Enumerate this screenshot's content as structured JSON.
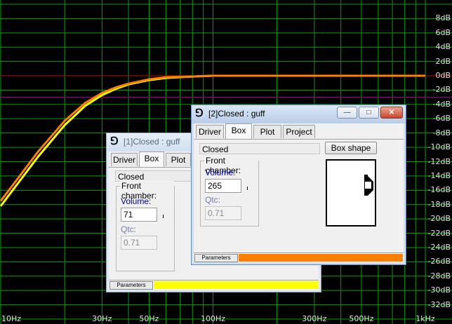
{
  "chart_data": {
    "type": "line",
    "title": "",
    "xlabel": "",
    "ylabel": "",
    "x_scale": "log",
    "xlim": [
      10,
      1000
    ],
    "ylim": [
      -34,
      10
    ],
    "x_ticks": [
      {
        "value": 10,
        "label": "10Hz"
      },
      {
        "value": 30,
        "label": "30Hz"
      },
      {
        "value": 50,
        "label": "50Hz"
      },
      {
        "value": 100,
        "label": "100Hz"
      },
      {
        "value": 300,
        "label": "300Hz"
      },
      {
        "value": 500,
        "label": "500Hz"
      },
      {
        "value": 1000,
        "label": "1kHz"
      }
    ],
    "y_ticks": [
      {
        "value": 8,
        "label": "8dB"
      },
      {
        "value": 6,
        "label": "6dB"
      },
      {
        "value": 4,
        "label": "4dB"
      },
      {
        "value": 2,
        "label": "2dB"
      },
      {
        "value": 0,
        "label": "0dB"
      },
      {
        "value": -2,
        "label": "-2dB"
      },
      {
        "value": -4,
        "label": "-4dB"
      },
      {
        "value": -6,
        "label": "-6dB"
      },
      {
        "value": -8,
        "label": "-8dB"
      },
      {
        "value": -10,
        "label": "-10dB"
      },
      {
        "value": -12,
        "label": "-12dB"
      },
      {
        "value": -14,
        "label": "-14dB"
      },
      {
        "value": -16,
        "label": "-16dB"
      },
      {
        "value": -18,
        "label": "-18dB"
      },
      {
        "value": -20,
        "label": "-20dB"
      },
      {
        "value": -22,
        "label": "-22dB"
      },
      {
        "value": -24,
        "label": "-24dB"
      },
      {
        "value": -26,
        "label": "-26dB"
      },
      {
        "value": -28,
        "label": "-28dB"
      },
      {
        "value": -30,
        "label": "-30dB"
      },
      {
        "value": -32,
        "label": "-32dB"
      }
    ],
    "grid": true,
    "reference_lines": [
      {
        "y": 0,
        "color": "#cc0000"
      },
      {
        "y": -3,
        "color": "#a000a0"
      }
    ],
    "series": [
      {
        "color": "#ffff00",
        "x": [
          10,
          12,
          15,
          20,
          25,
          30,
          35,
          40,
          50,
          60,
          80,
          100,
          150,
          200,
          300,
          400
        ],
        "y": [
          -18.2,
          -15.1,
          -11.3,
          -6.9,
          -4.2,
          -2.7,
          -1.8,
          -1.2,
          -0.6,
          -0.3,
          -0.1,
          0,
          0,
          0,
          0,
          0
        ]
      },
      {
        "color": "#ff8000",
        "x": [
          10,
          12,
          15,
          20,
          25,
          30,
          35,
          40,
          50,
          60,
          80,
          100,
          150,
          200,
          300,
          1000
        ],
        "y": [
          -17.5,
          -14.4,
          -10.6,
          -6.3,
          -3.8,
          -2.4,
          -1.6,
          -1.1,
          -0.5,
          -0.2,
          -0.1,
          0,
          0,
          0,
          0,
          0
        ]
      }
    ]
  },
  "window1": {
    "title": "[1]Closed : guff",
    "tabs": [
      "Driver",
      "Box",
      "Plot"
    ],
    "selected_tab": "Box",
    "box_type": "Closed",
    "group_label": "Front chamber:",
    "volume_label": "Volume:",
    "volume_value": "71",
    "qtc_label": "Qtc:",
    "qtc_value": "0.71",
    "status_label": "Parameters",
    "status_color": "#ffff00"
  },
  "window2": {
    "title": "[2]Closed : guff",
    "tabs": [
      "Driver",
      "Box",
      "Plot",
      "Project"
    ],
    "selected_tab": "Box",
    "box_type": "Closed",
    "box_shape_button": "Box shape",
    "group_label": "Front chamber:",
    "volume_label": "Volume:",
    "volume_value": "265",
    "qtc_label": "Qtc:",
    "qtc_value": "0.71",
    "status_label": "Parameters",
    "status_color": "#ff8000",
    "controls": {
      "minimize": "—",
      "maximize": "□",
      "close": "✕"
    }
  },
  "colors": {
    "plot_bg": "#000000",
    "grid": "#00a000",
    "axis_text": "#e0e0e0"
  }
}
